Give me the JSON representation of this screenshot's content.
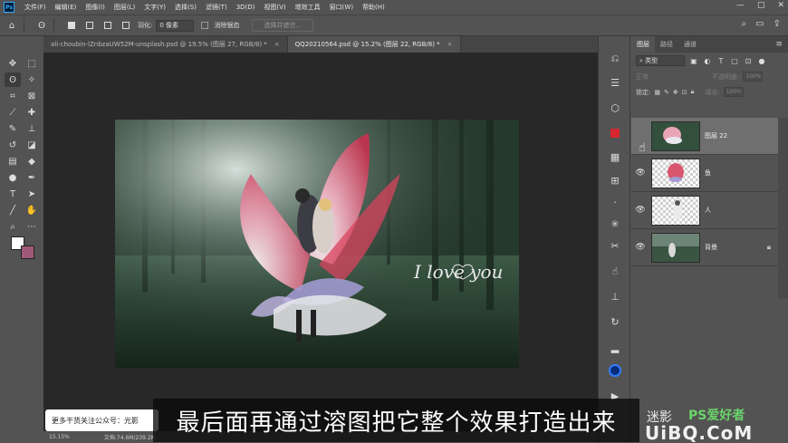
{
  "menubar": {
    "logo": "Ps",
    "items": [
      "文件(F)",
      "编辑(E)",
      "图像(I)",
      "图层(L)",
      "文字(Y)",
      "选择(S)",
      "滤镜(T)",
      "3D(D)",
      "视图(V)",
      "增效工具",
      "窗口(W)",
      "帮助(H)"
    ],
    "controls": [
      "—",
      "□",
      "✕"
    ]
  },
  "options": {
    "feather_label": "羽化:",
    "feather_value": "0 像素",
    "antialias_label": "消除锯齿",
    "select_mask_btn": "选择并遮住..."
  },
  "tabs": [
    {
      "label": "ali-choubin-lZnbzaUW52M-unsplash.psd @ 19.5% (图层 27, RGB/8) *",
      "close": "×"
    },
    {
      "label": "QQ20210564.psd @ 15.2% (图层 22, RGB/8) *",
      "close": "×"
    }
  ],
  "artwork": {
    "script_title": "I love you"
  },
  "status": {
    "zoom": "15.15%",
    "doc": "文档:74.6M/239.2M"
  },
  "layers_panel": {
    "tabs": [
      "图层",
      "路径",
      "通道"
    ],
    "filter_kind": "类型",
    "blend_mode": "正常",
    "opacity_label": "不透明度:",
    "opacity_value": "100%",
    "lock_label": "锁定:",
    "fill_label": "填充:",
    "fill_value": "100%",
    "layers": [
      {
        "name": "图层 22",
        "selected": true
      },
      {
        "name": "鱼",
        "selected": false
      },
      {
        "name": "人",
        "selected": false
      },
      {
        "name": "背景",
        "selected": false,
        "locked": true
      }
    ]
  },
  "overlay": {
    "subtitle": "最后面再通过溶图把它整个效果打造出来",
    "promo": "更多干货关注公众号：光影",
    "watermark_cn": "迷影",
    "watermark_ps": "PS爱好者",
    "watermark_site": "UiBQ.CoM"
  },
  "colors": {
    "foreground": "#ffffff",
    "background": "#a05a78",
    "accent": "#31a8ff"
  }
}
